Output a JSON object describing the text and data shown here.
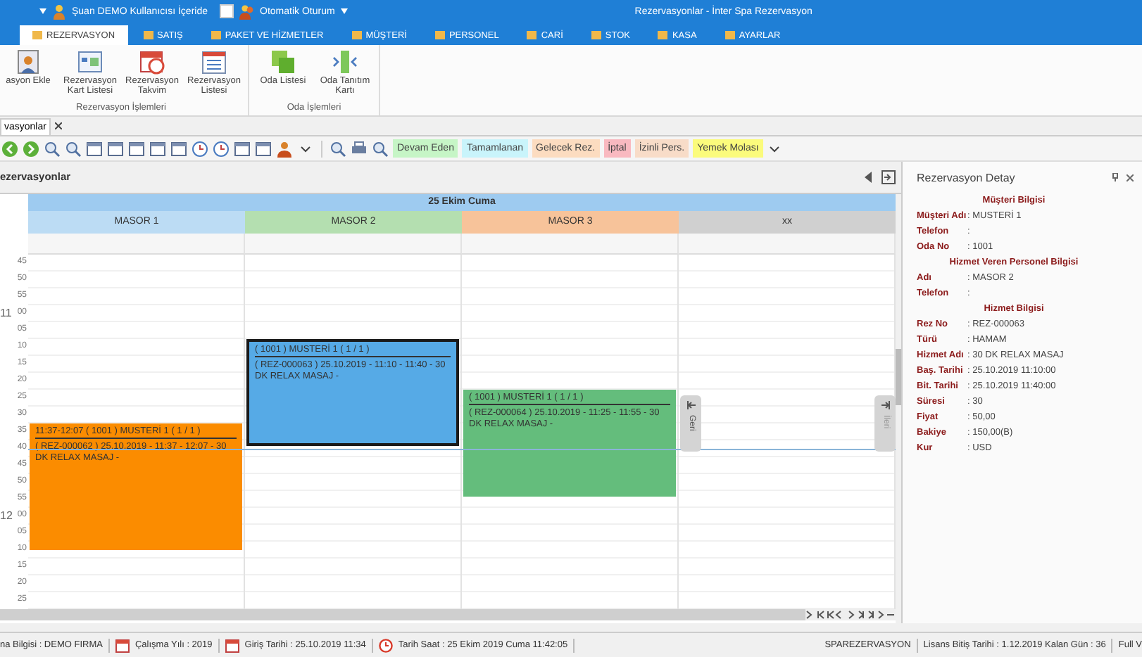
{
  "title_bar": {
    "user_status": "Şuan DEMO Kullanıcısı İçeride",
    "auto_login": {
      "label": "Otomatik Oturum",
      "checked": false
    },
    "title": "Rezervasyonlar - İnter Spa Rezervasyon"
  },
  "ribbon_tabs": [
    {
      "label": "REZERVASYON",
      "selected": true
    },
    {
      "label": "SATIŞ",
      "selected": false
    },
    {
      "label": "PAKET VE HİZMETLER",
      "selected": false
    },
    {
      "label": "MÜŞTERİ",
      "selected": false
    },
    {
      "label": "PERSONEL",
      "selected": false
    },
    {
      "label": "CARİ",
      "selected": false
    },
    {
      "label": "STOK",
      "selected": false
    },
    {
      "label": "KASA",
      "selected": false
    },
    {
      "label": "AYARLAR",
      "selected": false
    }
  ],
  "ribbon_groups": [
    {
      "label": "Rezervasyon İşlemleri",
      "buttons": [
        {
          "kind": "add",
          "label": "asyon Ekle"
        },
        {
          "kind": "card",
          "label": "Rezervasyon Kart Listesi"
        },
        {
          "kind": "calendar",
          "label": "Rezervasyon Takvim"
        },
        {
          "kind": "list",
          "label": "Rezervasyon Listesi"
        }
      ]
    },
    {
      "label": "Oda İşlemleri",
      "buttons": [
        {
          "kind": "rooms",
          "label": "Oda Listesi"
        },
        {
          "kind": "door",
          "label": "Oda Tanıtım Kartı"
        }
      ]
    }
  ],
  "document_tab": {
    "label": "vasyonlar"
  },
  "legend": [
    {
      "label": "Devam Eden",
      "color": "#c6f5c6"
    },
    {
      "label": "Tamamlanan",
      "color": "#c9f4fb"
    },
    {
      "label": "Gelecek Rez.",
      "color": "#fcdcc0"
    },
    {
      "label": "İptal",
      "color": "#f9b9c0"
    },
    {
      "label": "İzinli Pers.",
      "color": "#f8dcc8"
    },
    {
      "label": "Yemek Molası",
      "color": "#fbfb7c"
    }
  ],
  "panel_title": "ezervasyonlar",
  "calendar": {
    "day": "25 Ekim Cuma",
    "resources": [
      {
        "name": "MASOR 1",
        "color": "#bcdcf4",
        "appointments": [
          {
            "color": "#fb8c00",
            "selected": false,
            "title": "11:37-12:07  ( 1001 ) MUSTERİ 1  ( 1 / 1 )",
            "body": "( REZ-000062 ) 25.10.2019 - 11:37 - 12:07 - 30 DK RELAX MASAJ -"
          }
        ]
      },
      {
        "name": "MASOR 2",
        "color": "#b4dfb0",
        "appointments": [
          {
            "color": "#56aae6",
            "selected": true,
            "title": "( 1001 ) MUSTERİ 1  ( 1 / 1 )",
            "body": "( REZ-000063 ) 25.10.2019 - 11:10 - 11:40 - 30 DK RELAX MASAJ -"
          }
        ]
      },
      {
        "name": "MASOR 3",
        "color": "#f7c39a",
        "appointments": [
          {
            "color": "#64bd7c",
            "selected": false,
            "title": "( 1001 ) MUSTERİ 1  ( 1 / 1 )",
            "body": "( REZ-000064 ) 25.10.2019 - 11:25 - 11:55 - 30 DK RELAX MASAJ -"
          }
        ]
      },
      {
        "name": "xx",
        "color": "#d0d0d0"
      }
    ],
    "slots": [
      {
        "minute": "45"
      },
      {
        "minute": "50"
      },
      {
        "minute": "55"
      },
      {
        "hour": "11",
        "minute": "00"
      },
      {
        "minute": "05"
      },
      {
        "minute": "10"
      },
      {
        "minute": "15"
      },
      {
        "minute": "20"
      },
      {
        "minute": "25"
      },
      {
        "minute": "30"
      },
      {
        "minute": "35"
      },
      {
        "minute": "40"
      },
      {
        "minute": "45"
      },
      {
        "minute": "50"
      },
      {
        "minute": "55"
      },
      {
        "hour": "12",
        "minute": "00"
      },
      {
        "minute": "05"
      },
      {
        "minute": "10"
      },
      {
        "minute": "15"
      },
      {
        "minute": "20"
      },
      {
        "minute": "25"
      }
    ],
    "back_tab": "Geri",
    "next_tab": "İleri"
  },
  "detail": {
    "title": "Rezervasyon Detay",
    "sections": [
      {
        "heading": "Müşteri Bilgisi",
        "rows": [
          {
            "label": "Müşteri Adı",
            "value": ": MUSTERİ 1"
          },
          {
            "label": "Telefon",
            "value": ":"
          },
          {
            "label": "Oda No",
            "value": ": 1001"
          }
        ]
      },
      {
        "heading": "Hizmet Veren Personel Bilgisi",
        "rows": [
          {
            "label": "Adı",
            "value": ": MASOR 2"
          },
          {
            "label": "Telefon",
            "value": ":"
          }
        ]
      },
      {
        "heading": "Hizmet Bilgisi",
        "rows": [
          {
            "label": "Rez No",
            "value": ": REZ-000063"
          },
          {
            "label": "Türü",
            "value": ": HAMAM"
          },
          {
            "label": "Hizmet Adı",
            "value": ": 30 DK RELAX MASAJ"
          },
          {
            "label": "Baş. Tarihi",
            "value": ": 25.10.2019 11:10:00"
          },
          {
            "label": "Bit. Tarihi",
            "value": ": 25.10.2019 11:40:00"
          },
          {
            "label": "Süresi",
            "value": ": 30"
          },
          {
            "label": "Fiyat",
            "value": ": 50,00"
          },
          {
            "label": "Bakiye",
            "value": ": 150,00(B)"
          },
          {
            "label": "Kur",
            "value": ": USD"
          }
        ]
      }
    ]
  },
  "status_bar": {
    "left": [
      {
        "kind": "text",
        "text": "na Bilgisi : DEMO FIRMA"
      },
      {
        "kind": "calendar",
        "text": "Çalışma Yılı : 2019"
      },
      {
        "kind": "calendar",
        "text": "Giriş Tarihi :    25.10.2019 11:34"
      },
      {
        "kind": "clock",
        "text": "Tarih Saat :    25 Ekim 2019 Cuma 11:42:05"
      }
    ],
    "right": [
      "SPAREZERVASYON",
      "Lisans Bitiş Tarihi : 1.12.2019 Kalan Gün : 36",
      "Full V"
    ]
  }
}
